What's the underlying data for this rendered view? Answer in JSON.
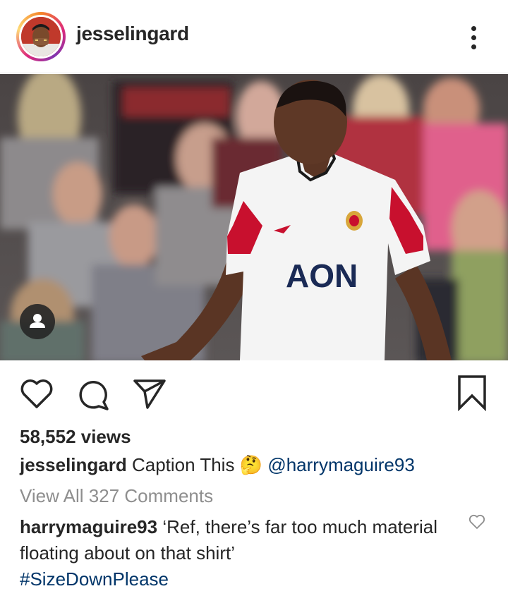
{
  "post": {
    "username": "jesselingard",
    "views": "58,552 views",
    "caption": {
      "username": "jesselingard",
      "text": "Caption This",
      "emoji": "🤔",
      "mention": "@harrymaguire93"
    },
    "view_all_comments": "View All 327 Comments",
    "comment": {
      "username": "harrymaguire93",
      "text": "‘Ref, there’s far too much material floating about on that shirt’",
      "hashtag": "#SizeDownPlease"
    },
    "media": {
      "shirt_text": "AON"
    }
  },
  "icons": {
    "more": "more-options-icon",
    "like": "heart-icon",
    "comment": "comment-icon",
    "share": "direct-share-icon",
    "save": "bookmark-icon",
    "tag": "user-tag-icon",
    "comment_like": "small-heart-icon"
  },
  "colors": {
    "text": "#262626",
    "secondary": "#8e8e8e",
    "link": "#003569"
  }
}
